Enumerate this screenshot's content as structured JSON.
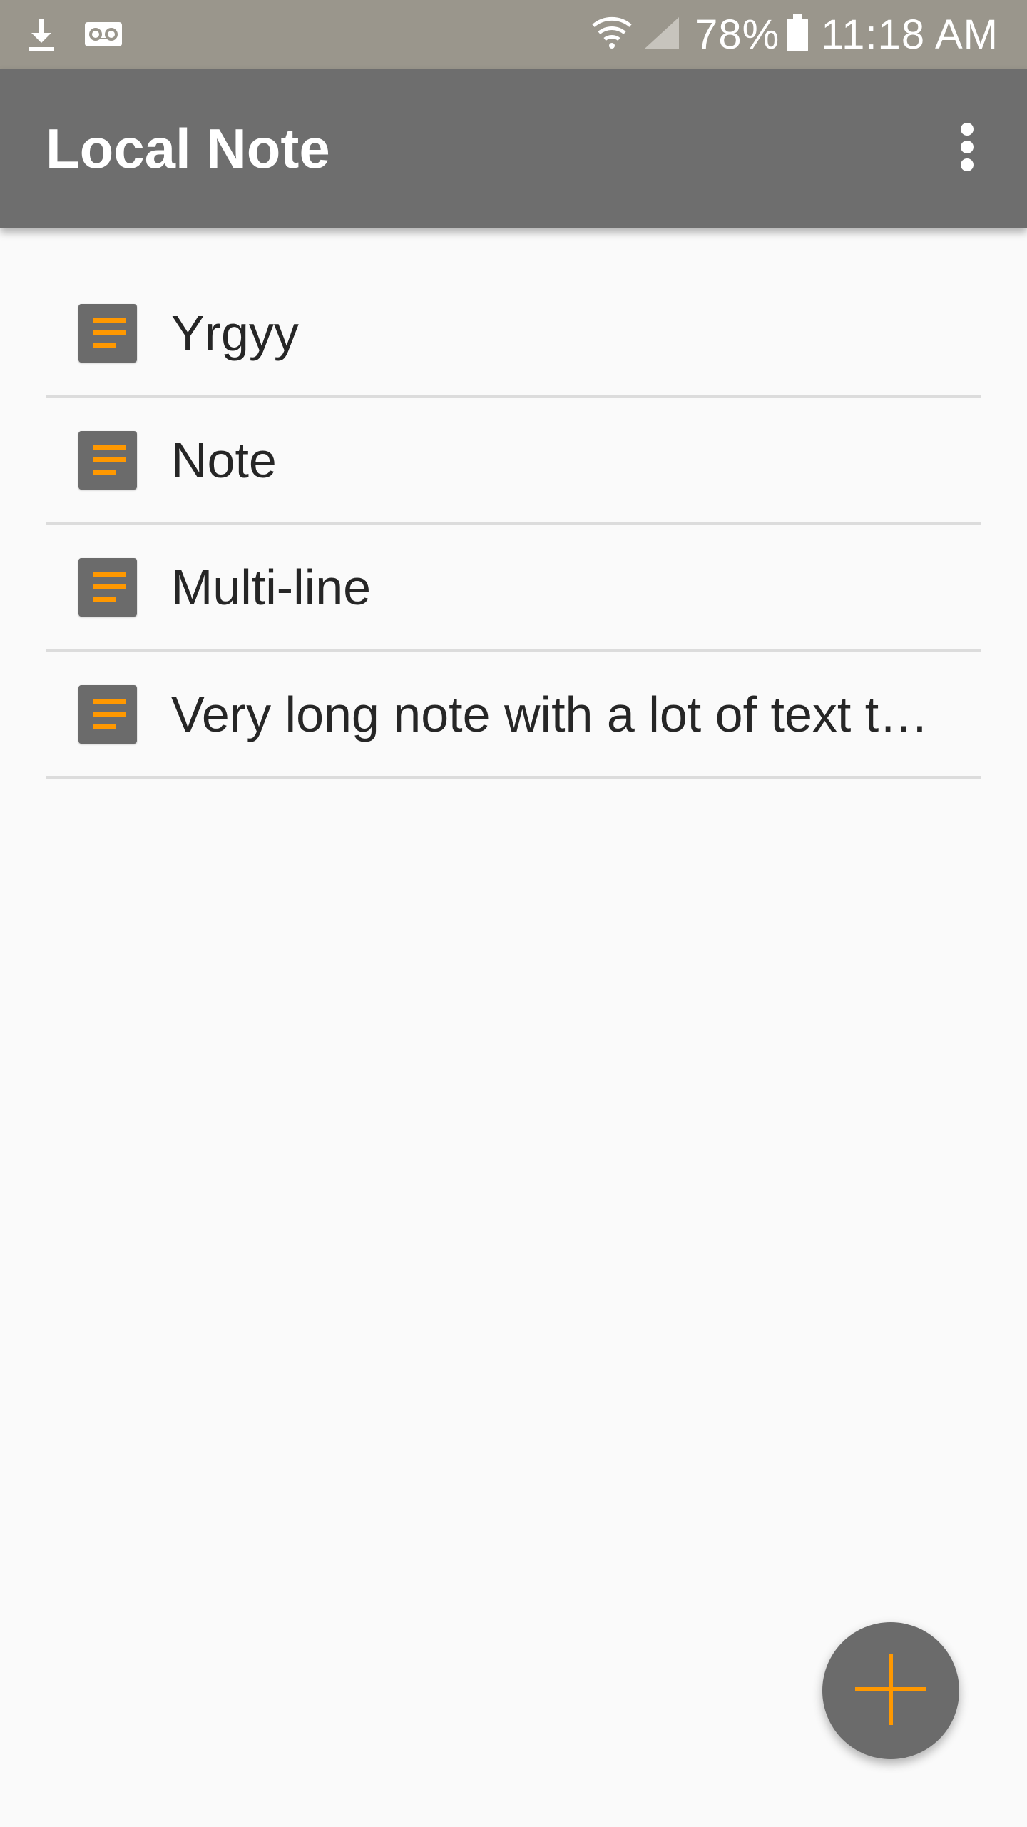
{
  "status_bar": {
    "left_icons": [
      "download-icon",
      "voicemail-icon"
    ],
    "battery_percent": "78%",
    "time": "11:18 AM",
    "right_icons": [
      "wifi-icon",
      "signal-icon",
      "battery-icon"
    ]
  },
  "app_bar": {
    "title": "Local Note",
    "overflow_icon": "more-vert-icon"
  },
  "notes": [
    {
      "title": "Yrgyy",
      "icon": "note-icon"
    },
    {
      "title": "Note",
      "icon": "note-icon"
    },
    {
      "title": "Multi-line",
      "icon": "note-icon"
    },
    {
      "title": "Very long note with a lot of text t…",
      "icon": "note-icon"
    }
  ],
  "fab": {
    "icon": "add-icon"
  },
  "colors": {
    "status_bar": "#9a968c",
    "app_bar": "#6e6e6e",
    "accent": "#ff9800",
    "background": "#fafafa",
    "divider": "#dcdcdc"
  }
}
